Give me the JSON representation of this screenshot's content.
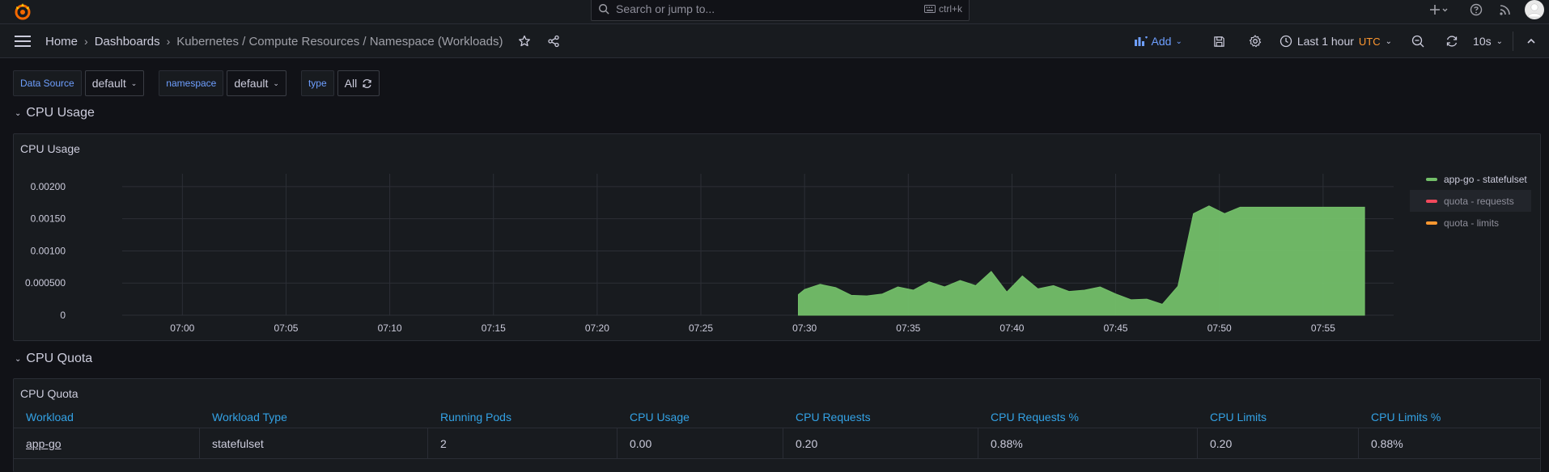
{
  "search": {
    "placeholder": "Search or jump to...",
    "shortcut": "ctrl+k"
  },
  "breadcrumb": {
    "home": "Home",
    "dashboards": "Dashboards",
    "current": "Kubernetes / Compute Resources / Namespace (Workloads)"
  },
  "toolbar": {
    "add_label": "Add",
    "time_range": "Last 1 hour",
    "timezone": "UTC",
    "refresh_interval": "10s"
  },
  "variables": [
    {
      "label": "Data Source",
      "value": "default"
    },
    {
      "label": "namespace",
      "value": "default"
    },
    {
      "label": "type",
      "value": "All"
    }
  ],
  "rows": {
    "cpu_usage": "CPU Usage",
    "cpu_quota": "CPU Quota"
  },
  "cpu_usage_panel": {
    "title": "CPU Usage",
    "legend": [
      {
        "name": "app-go - statefulset",
        "color": "#73bf69"
      },
      {
        "name": "quota - requests",
        "color": "#f2495c"
      },
      {
        "name": "quota - limits",
        "color": "#ff9830"
      }
    ]
  },
  "chart_data": {
    "type": "area",
    "title": "CPU Usage",
    "x_ticks": [
      "07:00",
      "07:05",
      "07:10",
      "07:15",
      "07:20",
      "07:25",
      "07:30",
      "07:35",
      "07:40",
      "07:45",
      "07:50",
      "07:55"
    ],
    "y_ticks": [
      "0",
      "0.000500",
      "0.00100",
      "0.00150",
      "0.00200"
    ],
    "ylim": [
      0,
      0.0022
    ],
    "grid": true,
    "legend_placement": "right",
    "series": [
      {
        "name": "app-go - statefulset",
        "color": "#73bf69",
        "x": [
          29.7,
          30.0,
          30.75,
          31.5,
          32.25,
          33.0,
          33.75,
          34.5,
          35.25,
          36.0,
          36.75,
          37.5,
          38.25,
          39.0,
          39.75,
          40.5,
          41.25,
          42.0,
          42.75,
          43.5,
          44.25,
          45.0,
          45.75,
          46.5,
          47.25,
          48.0,
          48.75,
          49.5,
          50.25,
          51.0,
          51.75,
          52.5,
          53.25,
          54.0,
          54.75,
          55.5,
          56.25,
          57.0
        ],
        "y": [
          0.00032,
          0.0004,
          0.00048,
          0.00043,
          0.00031,
          0.0003,
          0.00033,
          0.00044,
          0.00039,
          0.00052,
          0.00044,
          0.00054,
          0.00046,
          0.00068,
          0.00036,
          0.00061,
          0.00041,
          0.00046,
          0.00037,
          0.00039,
          0.00044,
          0.00033,
          0.00024,
          0.00025,
          0.00017,
          0.00045,
          0.00158,
          0.0017,
          0.00158,
          0.00168,
          0.00168,
          0.00168,
          0.00168,
          0.00168,
          0.00168,
          0.00168,
          0.00168,
          0.00168
        ]
      }
    ]
  },
  "cpu_quota_panel": {
    "title": "CPU Quota",
    "columns": [
      "Workload",
      "Workload Type",
      "Running Pods",
      "CPU Usage",
      "CPU Requests",
      "CPU Requests %",
      "CPU Limits",
      "CPU Limits %"
    ],
    "rows": [
      [
        "app-go",
        "statefulset",
        "2",
        "0.00",
        "0.20",
        "0.88%",
        "0.20",
        "0.88%"
      ]
    ]
  }
}
